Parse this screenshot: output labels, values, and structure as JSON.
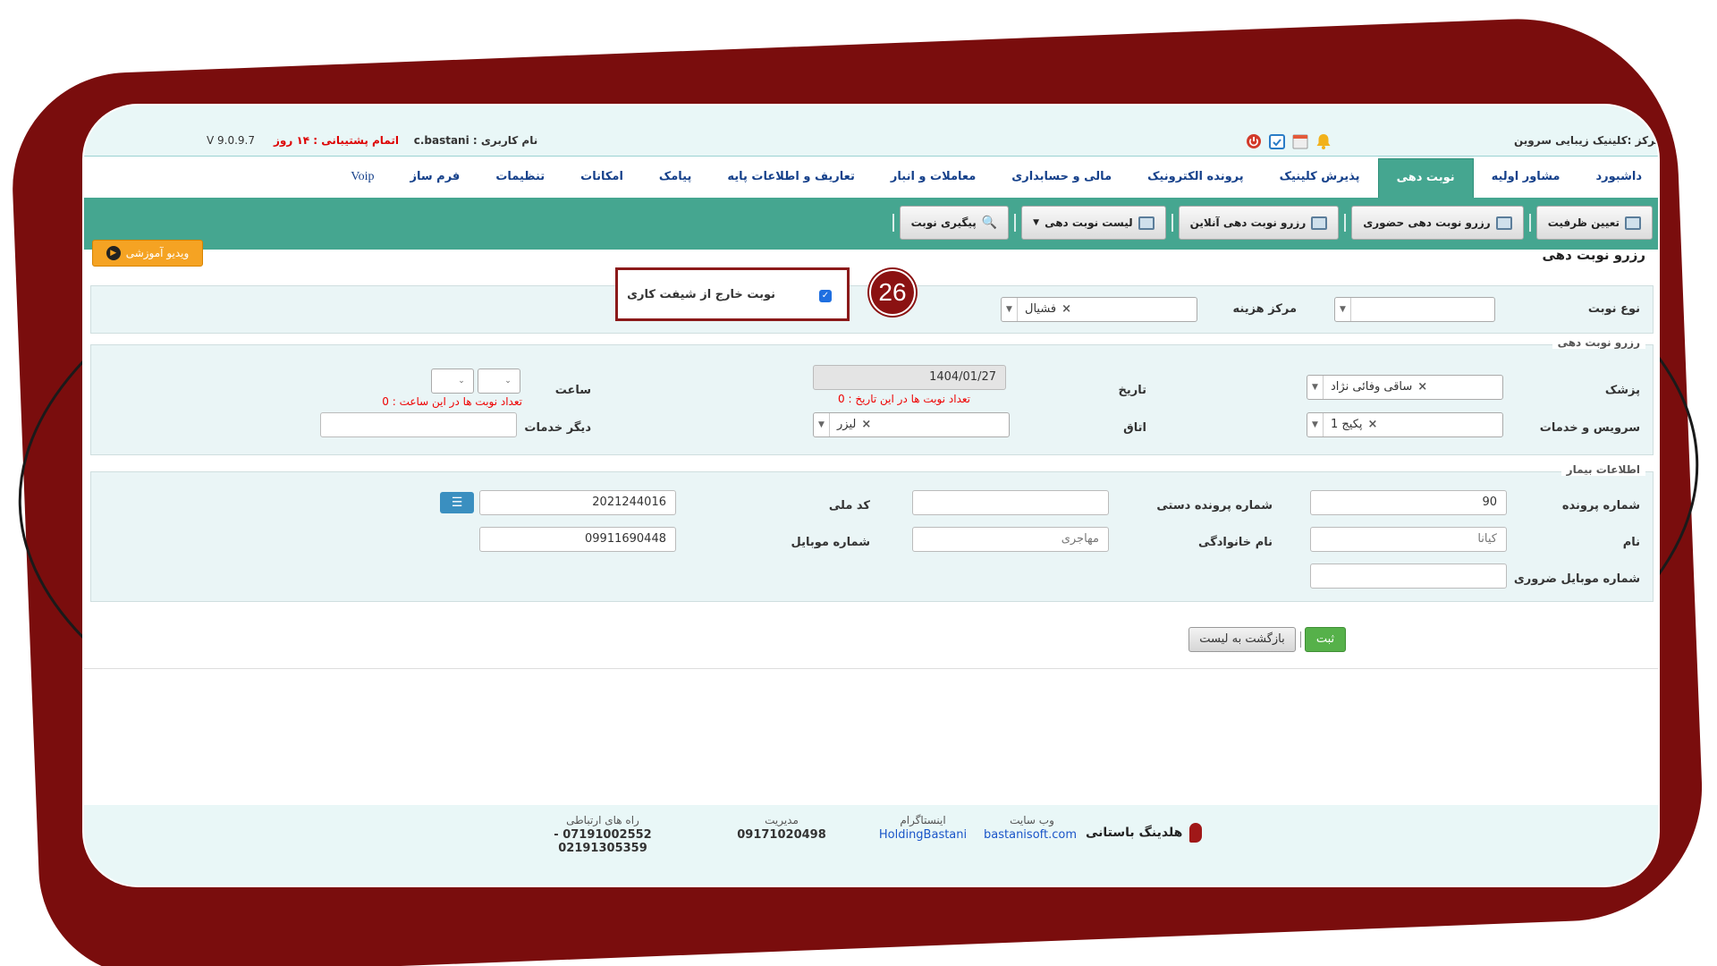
{
  "topbar": {
    "center_name": "مرکز :کلینیک زیبایی سروین",
    "username_label": "نام کاربری :",
    "username": "c.bastani",
    "support_label": "اتمام پشتیبانی :",
    "support_value": "۱۴ روز",
    "version": "V 9.0.9.7",
    "icons": [
      "bell-icon",
      "calendar-icon",
      "calendar-check-icon",
      "power-icon"
    ]
  },
  "menu": {
    "items": [
      "داشبورد",
      "مشاور اولیه",
      "نوبت دهی",
      "پذیرش کلینیک",
      "پرونده الکترونیک",
      "مالی و حسابداری",
      "معاملات و انبار",
      "تعاریف و اطلاعات پایه",
      "پیامک",
      "امکانات",
      "تنظیمات",
      "فرم ساز",
      "Voip"
    ],
    "active_index": 2
  },
  "submenu": {
    "items": [
      "تعیین ظرفیت",
      "رزرو نوبت دهی حضوری",
      "رزرو نوبت دهی آنلاین",
      "لیست نوبت دهی",
      "پیگیری نوبت"
    ]
  },
  "page": {
    "title": "رزرو نوبت دهی",
    "video_button": "ویدیو آموزشی"
  },
  "filters": {
    "appointment_type_label": "نوع نوبت",
    "appointment_type_value": "",
    "cost_center_label": "مرکز هزینه",
    "cost_center_value": "فشیال",
    "out_of_shift_label": "نوبت خارج از شیفت کاری",
    "out_of_shift_checked": true,
    "annotation_number": "26"
  },
  "reservation": {
    "legend": "رزرو نوبت دهی",
    "doctor_label": "پزشک",
    "doctor_value": "ساقی   وفائی نژاد",
    "date_label": "تاریخ",
    "date_value": "1404/01/27",
    "date_count_note": "تعداد نوبت ها در این تاریخ : 0",
    "time_label": "ساعت",
    "time_count_note": "تعداد نوبت ها در این ساعت : 0",
    "service_label": "سرویس و خدمات",
    "service_value": "پکیج 1",
    "room_label": "اتاق",
    "room_value": "لیزر",
    "other_services_label": "دیگر خدمات",
    "other_services_value": ""
  },
  "patient": {
    "legend": "اطلاعات بیمار",
    "file_no_label": "شماره پرونده",
    "file_no_value": "90",
    "manual_file_label": "شماره پرونده دستی",
    "manual_file_value": "",
    "national_id_label": "کد ملی",
    "national_id_value": "2021244016",
    "first_name_label": "نام",
    "first_name_value": "کیانا",
    "last_name_label": "نام خانوادگی",
    "last_name_value": "مهاجری",
    "mobile_label": "شماره موبایل",
    "mobile_value": "09911690448",
    "emergency_mobile_label": "شماره موبایل ضروری",
    "emergency_mobile_value": ""
  },
  "actions": {
    "save": "ثبت",
    "back": "بازگشت به لیست"
  },
  "footer": {
    "brand": "هلدینگ باستانی",
    "website_caption": "وب سایت",
    "website_value": "bastanisoft.com",
    "instagram_caption": "اینستاگرام",
    "instagram_value": "HoldingBastani",
    "management_caption": "مدیریت",
    "management_value": "09171020498",
    "contact_caption": "راه های ارتباطی",
    "contact_value": "07191002552 - 02191305359"
  },
  "colors": {
    "frame": "#7a0d0d",
    "submenu": "#45a690",
    "menu_text": "#15408a",
    "note_red": "#e00000"
  }
}
